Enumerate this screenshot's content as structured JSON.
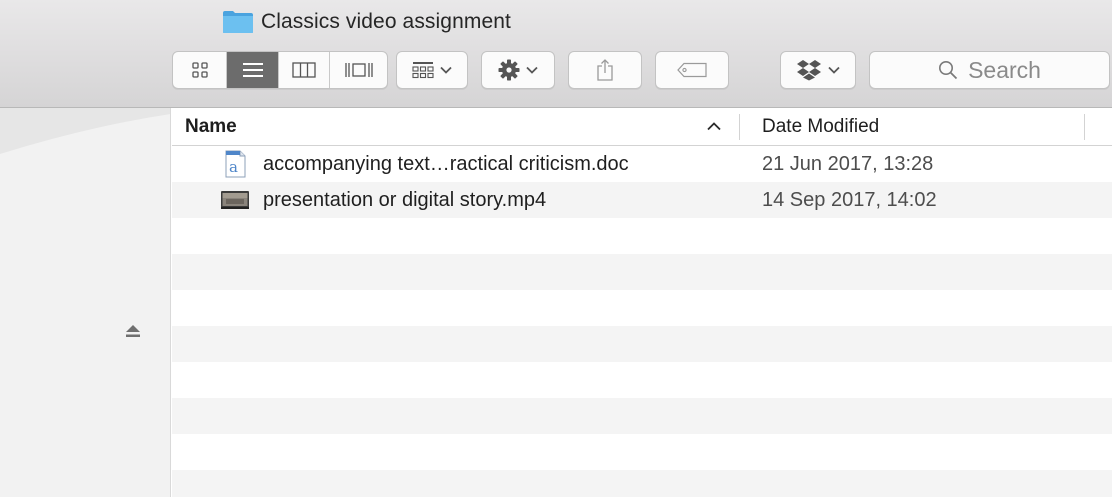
{
  "window": {
    "title": "Classics video assignment",
    "title_icon": "folder-icon"
  },
  "toolbar": {
    "view_modes": [
      {
        "name": "icon-view",
        "icon": "icon-view-icon",
        "active": false
      },
      {
        "name": "list-view",
        "icon": "list-view-icon",
        "active": true
      },
      {
        "name": "column-view",
        "icon": "column-view-icon",
        "active": false
      },
      {
        "name": "cover-flow-view",
        "icon": "cover-flow-icon",
        "active": false
      }
    ],
    "group_icon": "arrange-icon",
    "action_icon": "gear-icon",
    "share_icon": "share-icon",
    "tag_icon": "tag-icon",
    "dropbox_icon": "dropbox-icon",
    "search": {
      "placeholder": "Search",
      "icon": "search-icon"
    }
  },
  "list": {
    "columns": {
      "name": "Name",
      "date": "Date Modified"
    },
    "sort": "ascending",
    "files": [
      {
        "name": "accompanying text…ractical criticism.doc",
        "date": "21 Jun 2017, 13:28",
        "icon": "word-document-icon"
      },
      {
        "name": "presentation or digital story.mp4",
        "date": "14 Sep 2017, 14:02",
        "icon": "video-file-icon"
      }
    ]
  },
  "sidebar": {
    "eject_icon": "eject-icon"
  },
  "colors": {
    "toolbar_bg": "#dcdbdc",
    "active_segment": "#6c6c6c",
    "folder_blue": "#5ab1e8",
    "stripe": "#f4f4f4"
  }
}
